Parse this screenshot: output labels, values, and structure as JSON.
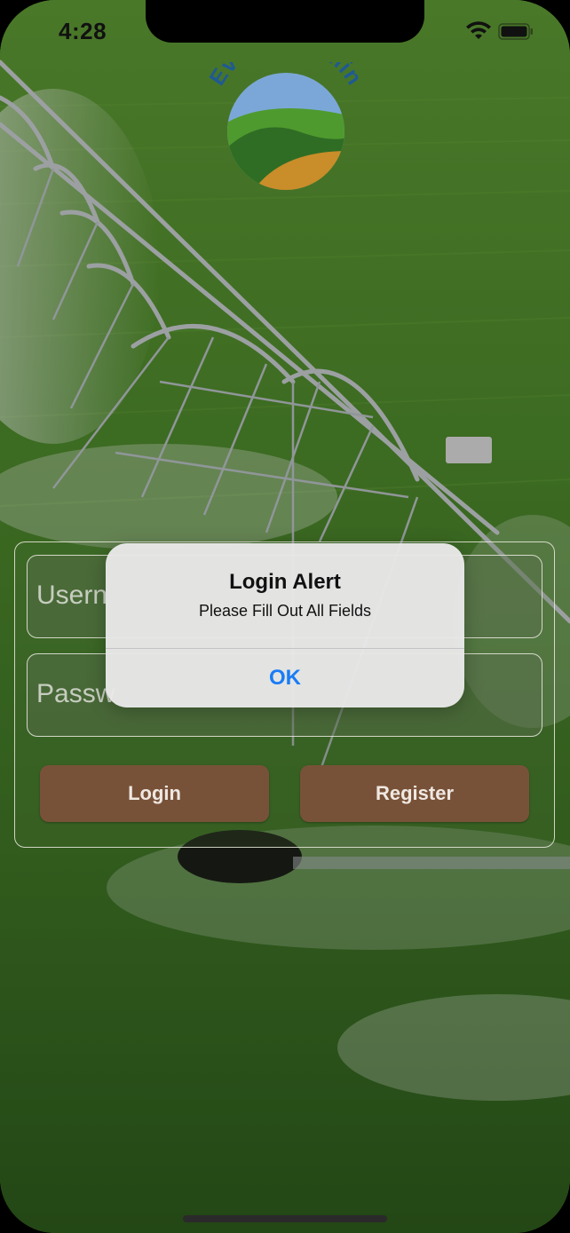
{
  "status_bar": {
    "time": "4:28"
  },
  "logo": {
    "text": "EvenStreamin"
  },
  "form": {
    "username_placeholder": "Usern",
    "password_placeholder": "Passw",
    "login_label": "Login",
    "register_label": "Register"
  },
  "alert": {
    "title": "Login Alert",
    "message": "Please Fill Out All Fields",
    "ok_label": "OK"
  },
  "colors": {
    "button_brown": "#785238",
    "alert_accent": "#1a7cf5",
    "logo_text": "#1f5a93"
  }
}
